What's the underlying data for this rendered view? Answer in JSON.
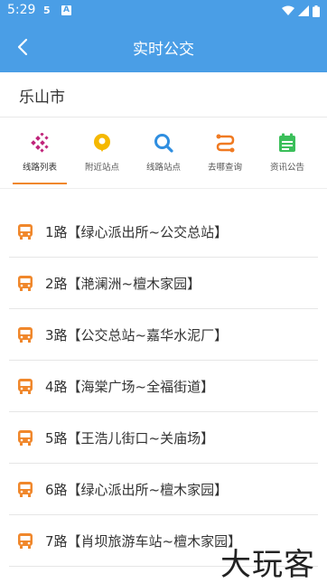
{
  "status_bar": {
    "time": "5:29",
    "indicator1": "5",
    "indicator2": "A"
  },
  "header": {
    "title": "实时公交"
  },
  "city": {
    "name": "乐山市"
  },
  "tabs": [
    {
      "label": "线路列表",
      "icon": "route-list-icon",
      "color": "#c0247a"
    },
    {
      "label": "附近站点",
      "icon": "location-pin-icon",
      "color": "#f5b800"
    },
    {
      "label": "线路站点",
      "icon": "search-icon",
      "color": "#2f8ee0"
    },
    {
      "label": "去哪查询",
      "icon": "route-path-icon",
      "color": "#f07a22"
    },
    {
      "label": "资讯公告",
      "icon": "calendar-notice-icon",
      "color": "#3bbf5a"
    }
  ],
  "routes": [
    {
      "text": "1路【绿心派出所~公交总站】"
    },
    {
      "text": "2路【滟澜洲~檀木家园】"
    },
    {
      "text": "3路【公交总站~嘉华水泥厂】"
    },
    {
      "text": "4路【海棠广场~全福街道】"
    },
    {
      "text": "5路【王浩儿街口~关庙场】"
    },
    {
      "text": "6路【绿心派出所~檀木家园】"
    },
    {
      "text": "7路【肖坝旅游车站~檀木家园】"
    }
  ],
  "watermark": {
    "text": "大玩客"
  },
  "colors": {
    "primary": "#4a9ee6",
    "accent": "#f0872b",
    "bus_icon": "#f0872b"
  }
}
